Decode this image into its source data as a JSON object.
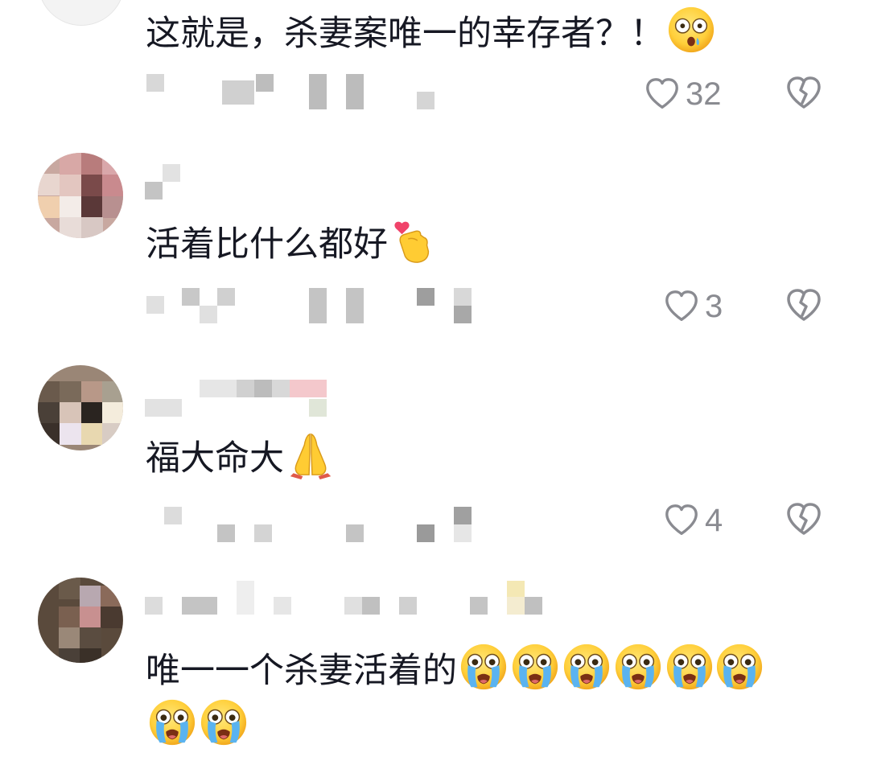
{
  "colors": {
    "text": "#161823",
    "secondary": "#8a8b91",
    "redacted": "#cfcfcf",
    "background": "#ffffff"
  },
  "comments": [
    {
      "text": "这就是，杀妻案唯一的幸存者？！",
      "emojis": [
        "astonished-face-icon"
      ],
      "likes": "32"
    },
    {
      "text": "活着比什么都好",
      "emojis": [
        "hand-with-heart-icon"
      ],
      "likes": "3"
    },
    {
      "text": "福大命大",
      "emojis": [
        "folded-hands-icon"
      ],
      "likes": "4"
    },
    {
      "text": "唯一一个杀妻活着的",
      "emojis": [
        "loudly-crying-face-icon",
        "loudly-crying-face-icon",
        "loudly-crying-face-icon",
        "loudly-crying-face-icon",
        "loudly-crying-face-icon",
        "loudly-crying-face-icon",
        "loudly-crying-face-icon",
        "loudly-crying-face-icon"
      ],
      "likes": ""
    }
  ]
}
